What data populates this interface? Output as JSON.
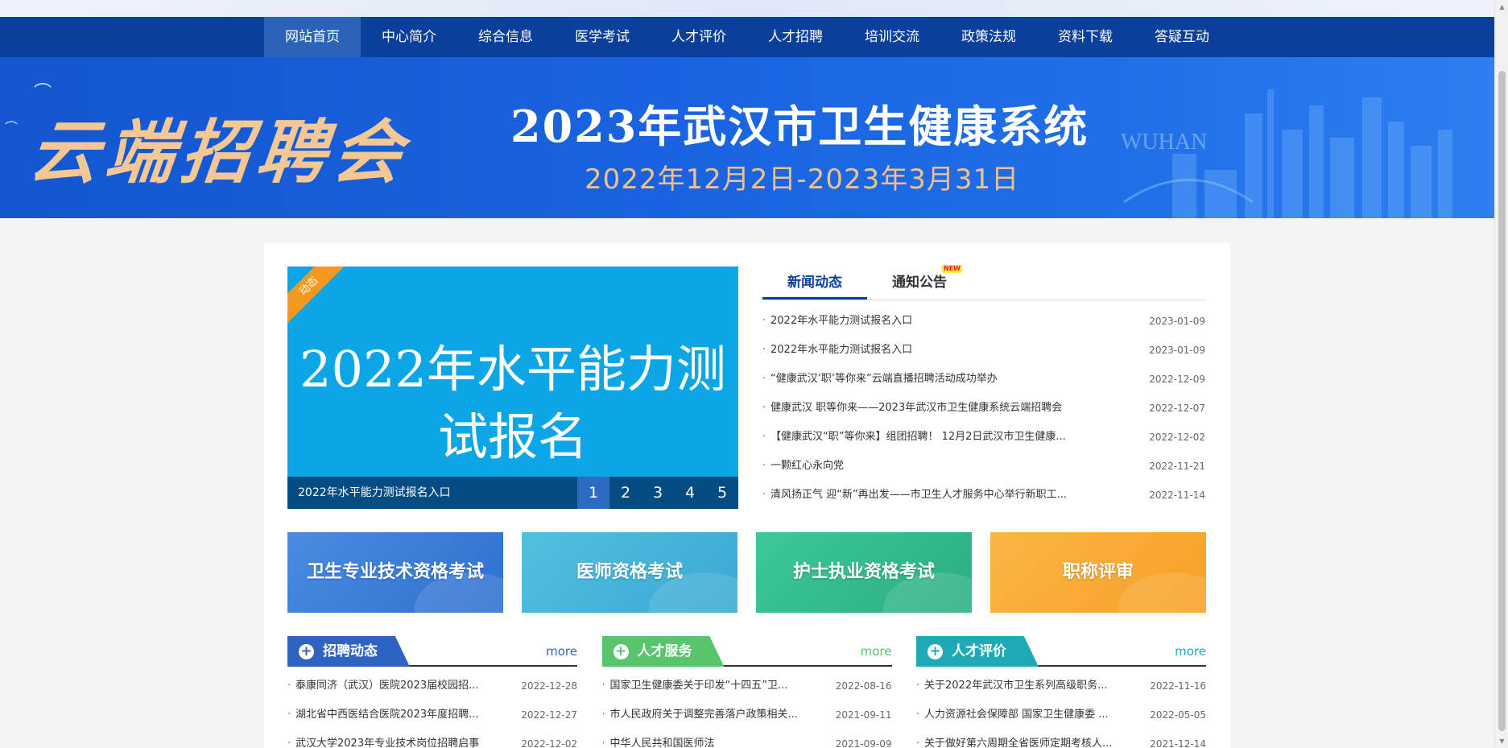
{
  "nav": {
    "items": [
      "网站首页",
      "中心简介",
      "综合信息",
      "医学考试",
      "人才评价",
      "人才招聘",
      "培训交流",
      "政策法规",
      "资料下载",
      "答疑互动"
    ]
  },
  "banner": {
    "cursive": "云端招聘会",
    "title": "2023年武汉市卫生健康系统",
    "date": "2022年12月2日-2023年3月31日",
    "watermark": "WUHAN"
  },
  "slider": {
    "tag": "动态",
    "headline": "2022年水平能力测试报名",
    "caption": "2022年水平能力测试报名入口",
    "pages": [
      "1",
      "2",
      "3",
      "4",
      "5"
    ],
    "active_page": "1"
  },
  "news": {
    "tabs": [
      "新闻动态",
      "通知公告"
    ],
    "new_badge": "NEW",
    "items": [
      {
        "title": "2022年水平能力测试报名入口",
        "date": "2023-01-09"
      },
      {
        "title": "2022年水平能力测试报名入口",
        "date": "2023-01-09"
      },
      {
        "title": "“健康武汉‘职’等你来”云端直播招聘活动成功举办",
        "date": "2022-12-09"
      },
      {
        "title": "健康武汉 职等你来——2023年武汉市卫生健康系统云端招聘会",
        "date": "2022-12-07"
      },
      {
        "title": "【健康武汉“职”等你来】组团招聘！ 12月2日武汉市卫生健康...",
        "date": "2022-12-02"
      },
      {
        "title": "一颗红心永向党",
        "date": "2022-11-21"
      },
      {
        "title": "清风扬正气 迎“新”再出发——市卫生人才服务中心举行新职工...",
        "date": "2022-11-14"
      }
    ]
  },
  "categories": [
    "卫生专业技术资格考试",
    "医师资格考试",
    "护士执业资格考试",
    "职称评审"
  ],
  "columns": [
    {
      "label": "招聘动态",
      "more": "more",
      "items": [
        {
          "title": "泰康同济（武汉）医院2023届校园招...",
          "date": "2022-12-28"
        },
        {
          "title": "湖北省中西医结合医院2023年度招聘...",
          "date": "2022-12-27"
        },
        {
          "title": "武汉大学2023年专业技术岗位招聘启事",
          "date": "2022-12-02"
        }
      ]
    },
    {
      "label": "人才服务",
      "more": "more",
      "items": [
        {
          "title": "国家卫生健康委关于印发“十四五”卫...",
          "date": "2022-08-16"
        },
        {
          "title": "市人民政府关于调整完善落户政策相关...",
          "date": "2021-09-11"
        },
        {
          "title": "中华人民共和国医师法",
          "date": "2021-09-09"
        }
      ]
    },
    {
      "label": "人才评价",
      "more": "more",
      "items": [
        {
          "title": "关于2022年武汉市卫生系列高级职务...",
          "date": "2022-11-16"
        },
        {
          "title": "人力资源社会保障部 国家卫生健康委 ...",
          "date": "2022-05-05"
        },
        {
          "title": "关于做好第六周期全省医师定期考核人...",
          "date": "2021-12-14"
        }
      ]
    }
  ],
  "colors": {
    "nav": "#0a3f9c",
    "nav_active": "#2b63b9",
    "banner_gold": "#f1c08c",
    "slider_bg": "#0ca6e6",
    "col_blue": "#2e63c2",
    "col_green": "#58c46c",
    "col_teal": "#1fa9b6"
  }
}
